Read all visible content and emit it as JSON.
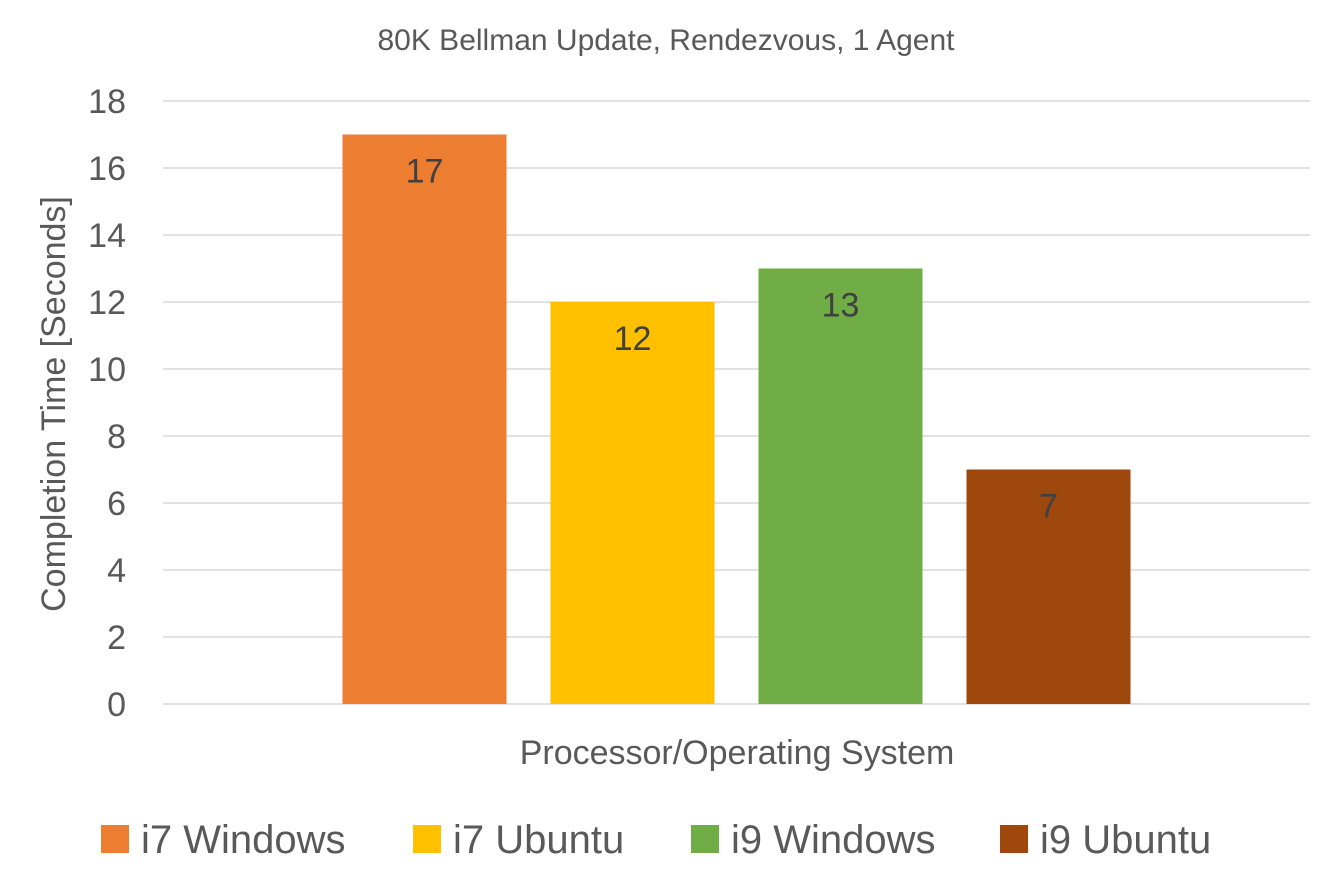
{
  "chart_data": {
    "type": "bar",
    "title": "80K Bellman Update, Rendezvous, 1 Agent",
    "xlabel": "Processor/Operating System",
    "ylabel": "Completion Time [Seconds]",
    "ylim": [
      0,
      18
    ],
    "yticks": [
      0,
      2,
      4,
      6,
      8,
      10,
      12,
      14,
      16,
      18
    ],
    "grid": true,
    "legend_position": "bottom",
    "series": [
      {
        "name": "i7 Windows",
        "values": [
          17
        ],
        "color": "#ED7D31"
      },
      {
        "name": "i7 Ubuntu",
        "values": [
          12
        ],
        "color": "#FFC000"
      },
      {
        "name": "i9 Windows",
        "values": [
          13
        ],
        "color": "#70AD47"
      },
      {
        "name": "i9 Ubuntu",
        "values": [
          7
        ],
        "color": "#9E480E"
      }
    ]
  }
}
